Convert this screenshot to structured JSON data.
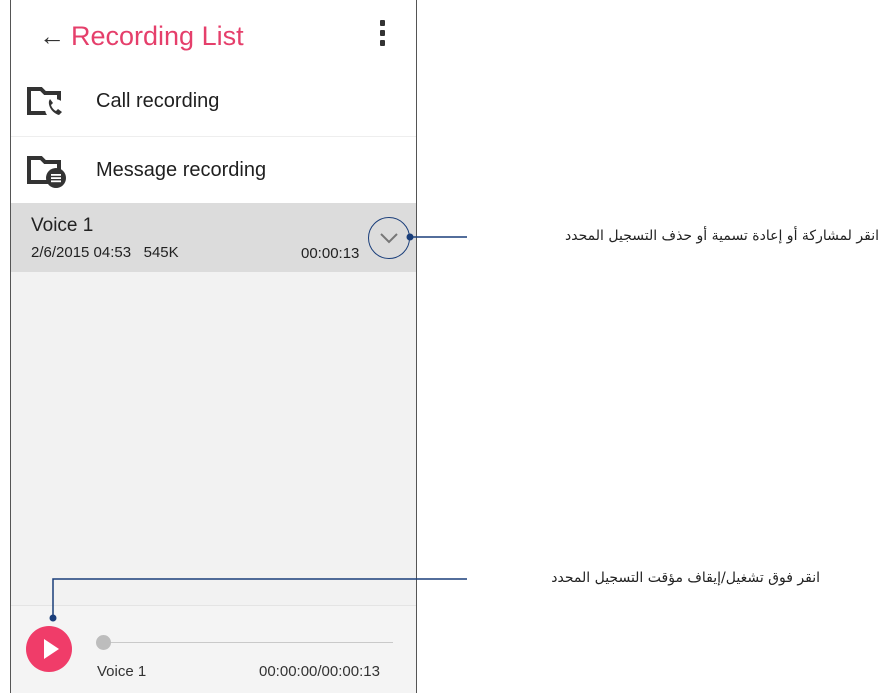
{
  "appbar": {
    "back_icon": "arrow-left-icon",
    "title": "Recording List",
    "menu_icon": "more-vert-icon",
    "accent_color": "#e53f6b"
  },
  "folders": [
    {
      "label": "Call recording",
      "icon": "call-folder-icon"
    },
    {
      "label": "Message recording",
      "icon": "message-folder-icon"
    }
  ],
  "recordings": [
    {
      "name": "Voice 1",
      "date": "2/6/2015 04:53",
      "size": "545K",
      "duration": "00:00:13",
      "icon": "chevron-down-icon"
    }
  ],
  "player": {
    "play_icon": "play-icon",
    "name": "Voice 1",
    "time": "00:00:00/00:00:13",
    "progress": 0,
    "button_color": "#f03c69"
  },
  "callouts": {
    "expand": "انقر لمشاركة أو إعادة تسمية أو حذف التسجيل المحدد",
    "play": "انقر فوق تشغيل/إيقاف مؤقت التسجيل المحدد",
    "line_color": "#1a3e7a"
  }
}
